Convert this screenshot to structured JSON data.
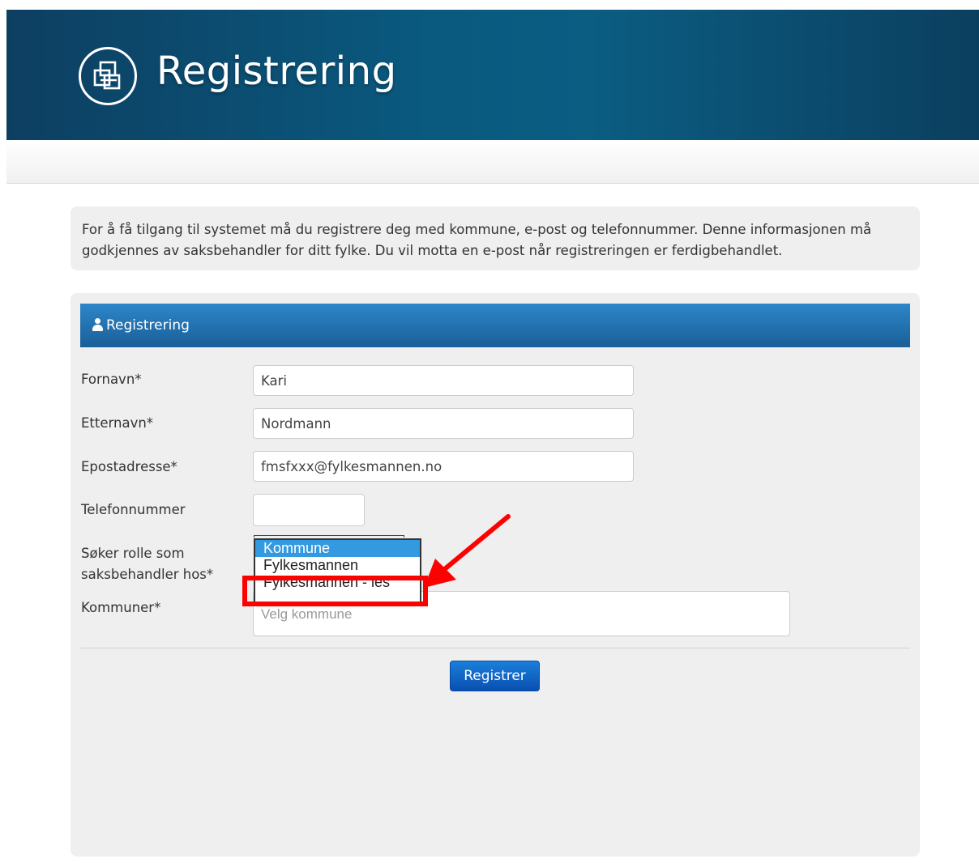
{
  "banner": {
    "title": "Registrering",
    "logo_icon": "overlapping-squares-icon"
  },
  "info": {
    "line1": "For å få tilgang til systemet må du registrere deg med kommune, e-post og telefonnummer. Denne informasjonen må",
    "line2": "godkjennes av saksbehandler for ditt fylke. Du vil motta en e-post når registreringen er ferdigbehandlet."
  },
  "panel": {
    "title": "Registrering",
    "icon": "user-icon"
  },
  "form": {
    "first_name": {
      "label": "Fornavn*",
      "value": "Kari"
    },
    "last_name": {
      "label": "Etternavn*",
      "value": "Nordmann"
    },
    "email": {
      "label": "Epostadresse*",
      "value": "fmsfxxx@fylkesmannen.no"
    },
    "phone": {
      "label": "Telefonnummer",
      "value": ""
    },
    "role": {
      "label_line1": "Søker rolle som",
      "label_line2": "saksbehandler hos*",
      "options": [
        "Kommune",
        "Fylkesmannen",
        "Fylkesmannen - les"
      ],
      "selected": "Kommune"
    },
    "municipalities": {
      "label": "Kommuner*",
      "placeholder": "Velg kommune"
    },
    "submit_label": "Registrer"
  },
  "colors": {
    "banner_dark": "#0d3f61",
    "banner_accent": "#0a5a80",
    "panel_header": "#1a5f98",
    "selected_option": "#3399e0",
    "annotation": "#ff0000",
    "button": "#0a4fb0"
  }
}
